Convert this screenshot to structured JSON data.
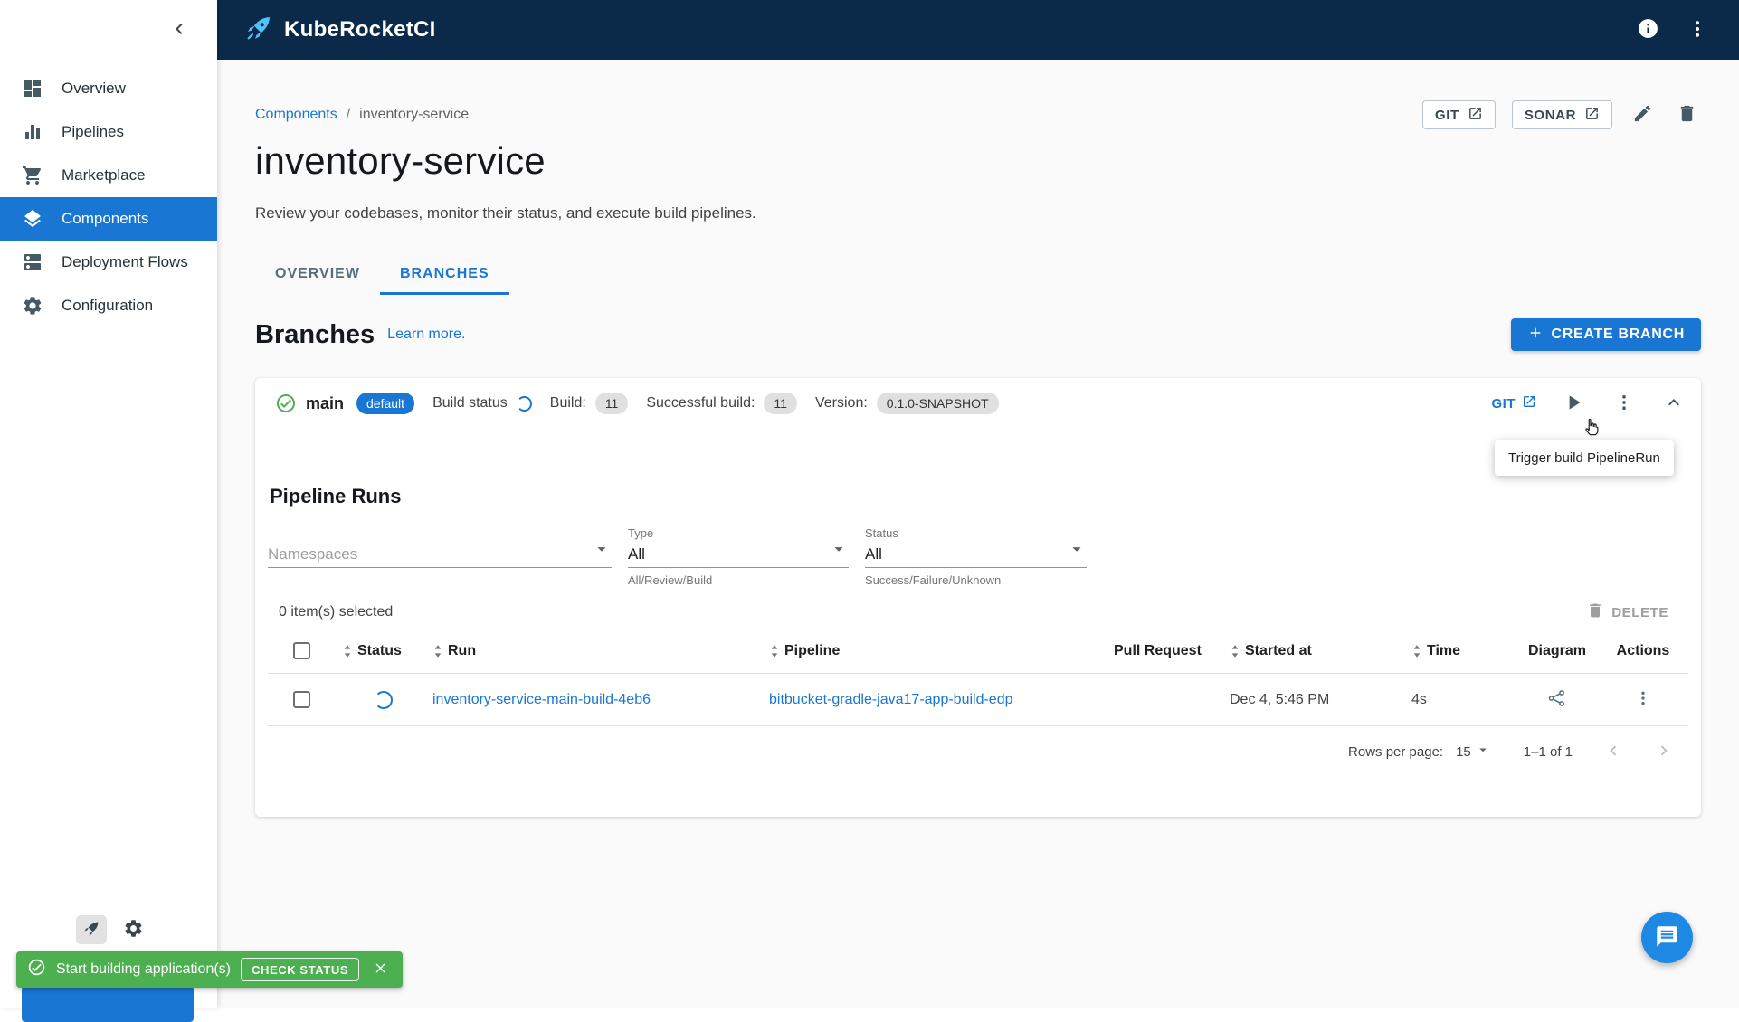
{
  "colors": {
    "primary": "#1976d2",
    "topbar_bg": "#0b2a4a",
    "success": "#4caf50",
    "link": "#1976d2"
  },
  "topbar": {
    "title": "KubeRocketCI"
  },
  "sidebar": {
    "items": [
      {
        "label": "Overview"
      },
      {
        "label": "Pipelines"
      },
      {
        "label": "Marketplace"
      },
      {
        "label": "Components",
        "selected": true
      },
      {
        "label": "Deployment Flows"
      },
      {
        "label": "Configuration"
      }
    ]
  },
  "page": {
    "breadcrumb": {
      "root": "Components",
      "separator": "/",
      "current": "inventory-service"
    },
    "title": "inventory-service",
    "subtitle": "Review your codebases, monitor their status, and execute build pipelines.",
    "actions": {
      "git": "GIT",
      "sonar": "SONAR"
    },
    "tabs": [
      {
        "label": "OVERVIEW",
        "active": false
      },
      {
        "label": "BRANCHES",
        "active": true
      }
    ]
  },
  "branches": {
    "heading": "Branches",
    "learn_more": "Learn more.",
    "create_button": "CREATE BRANCH"
  },
  "branch": {
    "name": "main",
    "default_chip": "default",
    "build_status_label": "Build status",
    "build_label": "Build:",
    "build_value": "11",
    "successful_build_label": "Successful build:",
    "successful_build_value": "11",
    "version_label": "Version:",
    "version_value": "0.1.0-SNAPSHOT",
    "git_link": "GIT",
    "play_tooltip": "Trigger build PipelineRun"
  },
  "pipeline_runs": {
    "heading": "Pipeline Runs",
    "filters": {
      "namespaces": {
        "placeholder": "Namespaces"
      },
      "type": {
        "label": "Type",
        "value": "All",
        "helper": "All/Review/Build"
      },
      "status": {
        "label": "Status",
        "value": "All",
        "helper": "Success/Failure/Unknown"
      }
    },
    "selection": "0 item(s) selected",
    "delete_button": "DELETE",
    "table": {
      "columns": [
        {
          "label": "Status",
          "sortable": true
        },
        {
          "label": "Run",
          "sortable": true
        },
        {
          "label": "Pipeline",
          "sortable": true
        },
        {
          "label": "Pull Request",
          "sortable": false
        },
        {
          "label": "Started at",
          "sortable": true
        },
        {
          "label": "Time",
          "sortable": true
        },
        {
          "label": "Diagram",
          "sortable": false
        },
        {
          "label": "Actions",
          "sortable": false
        }
      ],
      "rows": [
        {
          "run": "inventory-service-main-build-4eb6",
          "pipeline": "bitbucket-gradle-java17-app-build-edp",
          "pull_request": "",
          "started_at": "Dec 4, 5:46 PM",
          "time": "4s"
        }
      ]
    },
    "pagination": {
      "rows_per_page_label": "Rows per page:",
      "rows_per_page_value": "15",
      "range": "1–1 of 1"
    }
  },
  "snackbar": {
    "message": "Start building application(s)",
    "action": "CHECK STATUS"
  },
  "icons": {
    "kebab-menu-icon": "⋮",
    "info-icon": "ⓘ",
    "close-icon": "✕",
    "check-circle-icon": "✓",
    "chevron-left-icon": "‹",
    "chevron-up-icon": "⌃",
    "play-icon": "▶",
    "plus-icon": "+",
    "sort-icon": "⇅",
    "dropdown-caret-icon": "▾"
  }
}
